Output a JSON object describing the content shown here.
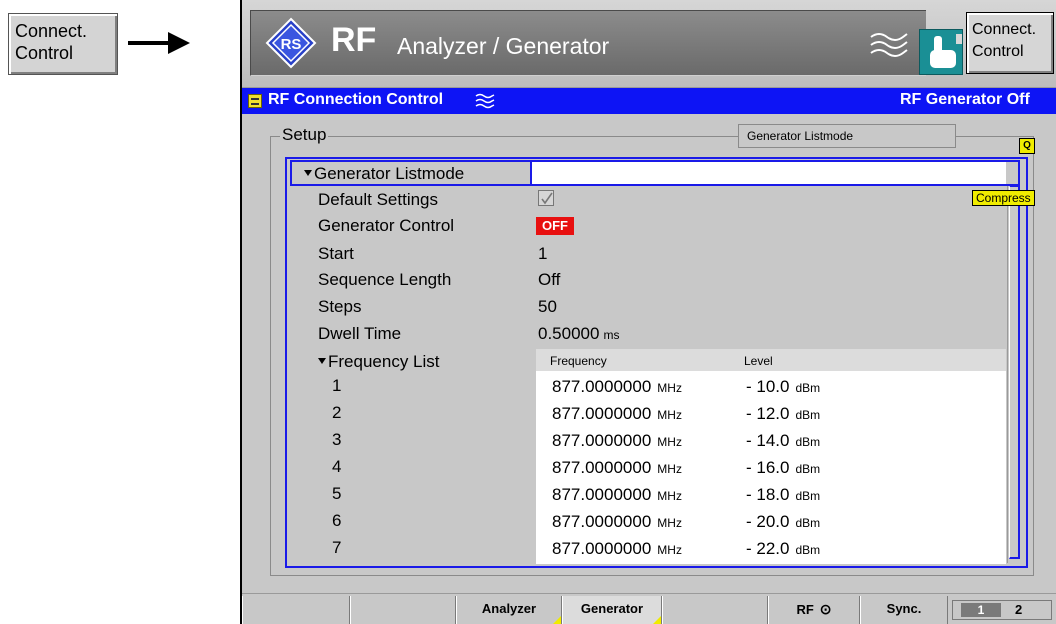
{
  "side_button": {
    "line1": "Connect.",
    "line2": "Control"
  },
  "title": {
    "rf": "RF",
    "subtitle": "Analyzer / Generator"
  },
  "top_button": {
    "line1": "Connect.",
    "line2": "Control"
  },
  "menu": {
    "title": "RF Connection Control",
    "status": "RF Generator Off"
  },
  "setup": {
    "label": "Setup",
    "tab_label": "Generator Listmode",
    "q_badge": "Q",
    "compress": "Compress",
    "listmode_label": "Generator Listmode",
    "rows": [
      {
        "label": "Default Settings"
      },
      {
        "label": "Generator Control",
        "value": "OFF"
      },
      {
        "label": "Start",
        "value": "1"
      },
      {
        "label": "Sequence Length",
        "value": "Off"
      },
      {
        "label": "Steps",
        "value": "50"
      },
      {
        "label": "Dwell Time",
        "value": "0.50000",
        "unit": "ms"
      }
    ],
    "default_settings_checked": true,
    "frequency_list": {
      "label": "Frequency List",
      "col_frequency": "Frequency",
      "col_level": "Level",
      "freq_unit": "MHz",
      "level_unit": "dBm",
      "entries": [
        {
          "index": "1",
          "frequency": "877.0000000",
          "level": "- 10.0"
        },
        {
          "index": "2",
          "frequency": "877.0000000",
          "level": "- 12.0"
        },
        {
          "index": "3",
          "frequency": "877.0000000",
          "level": "- 14.0"
        },
        {
          "index": "4",
          "frequency": "877.0000000",
          "level": "- 16.0"
        },
        {
          "index": "5",
          "frequency": "877.0000000",
          "level": "- 18.0"
        },
        {
          "index": "6",
          "frequency": "877.0000000",
          "level": "- 20.0"
        },
        {
          "index": "7",
          "frequency": "877.0000000",
          "level": "- 22.0"
        }
      ]
    }
  },
  "tabs": {
    "analyzer": "Analyzer",
    "generator": "Generator",
    "rf": "RF",
    "sync": "Sync.",
    "page1": "1",
    "page2": "2"
  },
  "colors": {
    "menu_blue": "#0d14f5",
    "off_red": "#e81010",
    "highlight_yellow": "#f0ec00",
    "hand_teal": "#1a8f95"
  }
}
